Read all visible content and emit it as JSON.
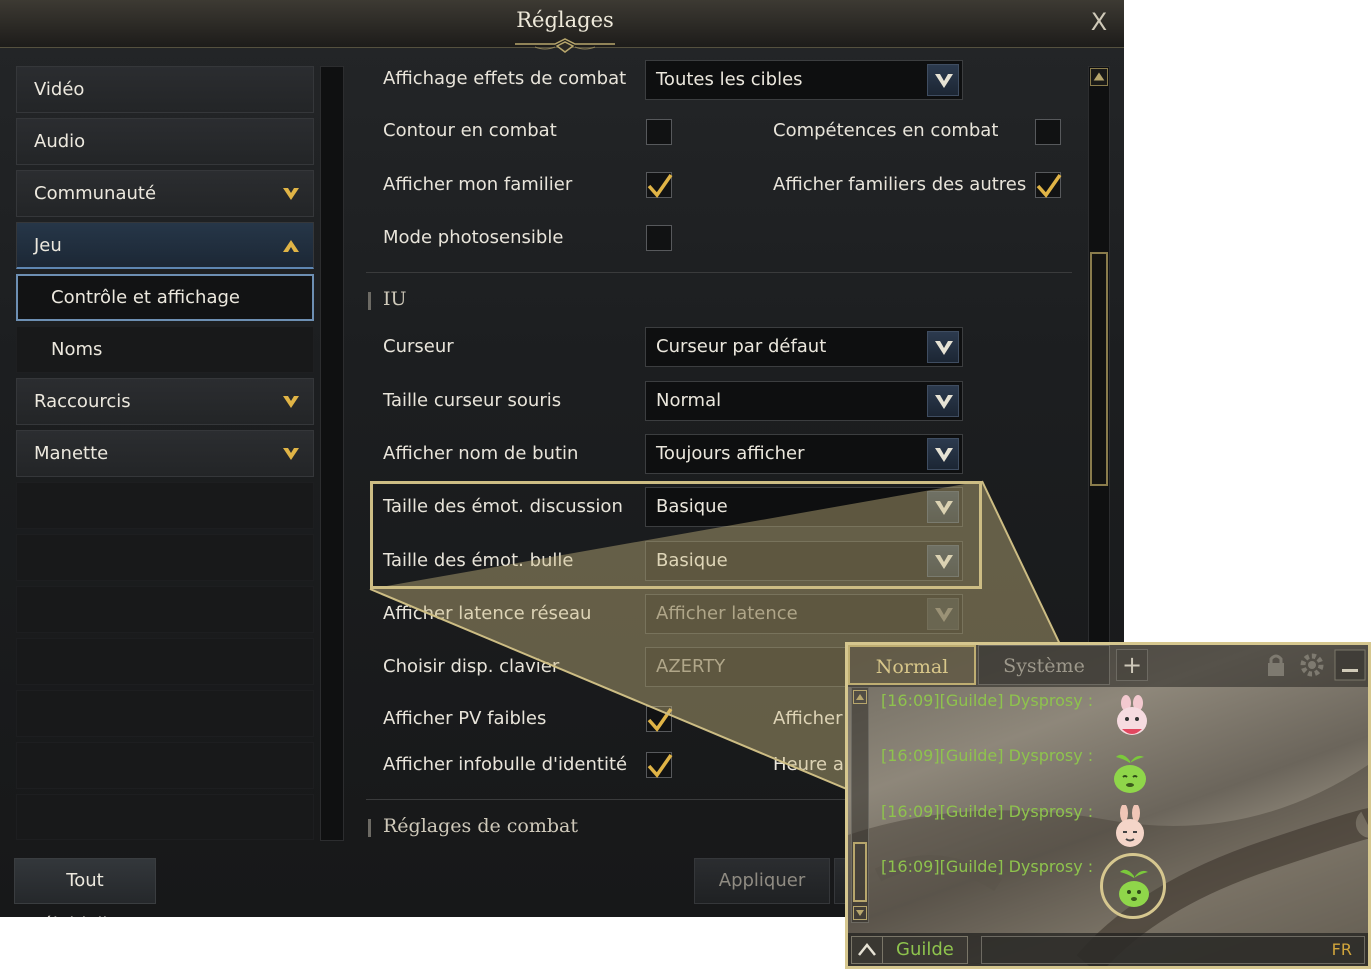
{
  "window": {
    "title": "Réglages",
    "close_label": "X"
  },
  "nav": {
    "items": [
      {
        "label": "Vidéo"
      },
      {
        "label": "Audio"
      },
      {
        "label": "Communauté"
      },
      {
        "label": "Jeu"
      },
      {
        "label": "Contrôle et affichage"
      },
      {
        "label": "Noms"
      },
      {
        "label": "Raccourcis"
      },
      {
        "label": "Manette"
      }
    ]
  },
  "buttons": {
    "reset": "Tout réinitialiser",
    "apply": "Appliquer"
  },
  "settings": {
    "combat_effects": {
      "label": "Affichage effets de combat",
      "value": "Toutes les cibles"
    },
    "combat_outline": {
      "label": "Contour en combat",
      "checked": false
    },
    "combat_skills": {
      "label": "Compétences en combat",
      "checked": false
    },
    "show_my_pet": {
      "label": "Afficher mon familier",
      "checked": true
    },
    "show_others_pets": {
      "label": "Afficher familiers des autres",
      "checked": true
    },
    "photosensitive": {
      "label": "Mode photosensible",
      "checked": false
    }
  },
  "ui_section": {
    "title": "IU",
    "cursor": {
      "label": "Curseur",
      "value": "Curseur par défaut"
    },
    "cursor_size": {
      "label": "Taille curseur souris",
      "value": "Normal"
    },
    "loot_name": {
      "label": "Afficher nom de butin",
      "value": "Toujours afficher"
    },
    "chat_emote_size": {
      "label": "Taille des émot. discussion",
      "value": "Basique"
    },
    "bubble_emote_size": {
      "label": "Taille des émot. bulle",
      "value": "Basique"
    },
    "network_latency": {
      "label": "Afficher latence réseau",
      "value": "Afficher latence"
    },
    "keyboard_layout": {
      "label": "Choisir disp. clavier",
      "value": "AZERTY"
    },
    "low_hp": {
      "label": "Afficher PV faibles",
      "checked": true
    },
    "low_hp_right_partial": "Afficher",
    "identity_tooltip": {
      "label": "Afficher infobulle d'identité",
      "checked": true
    },
    "identity_right_partial": "Heure au"
  },
  "combat_section": {
    "title": "Réglages de combat"
  },
  "chat": {
    "tabs": [
      "Normal",
      "Système"
    ],
    "add_tab": "+",
    "lines": [
      "[16:09][Guilde] Dysprosy :",
      "[16:09][Guilde] Dysprosy :",
      "[16:09][Guilde] Dysprosy :",
      "[16:09][Guilde] Dysprosy :"
    ],
    "channel": "Guilde",
    "language": "FR",
    "channel_color": "#8ec34d"
  },
  "colors": {
    "accent_gold": "#cdbd84",
    "selection_blue": "#6d8fb3",
    "check_gold": "#e0b446"
  }
}
